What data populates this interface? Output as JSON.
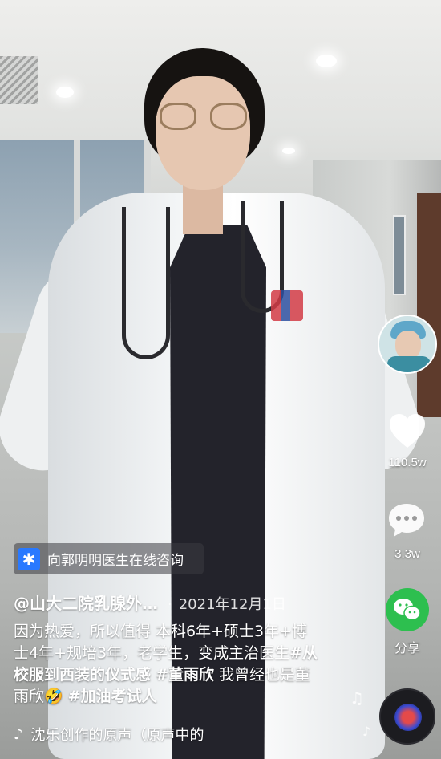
{
  "consult_banner": {
    "icon_glyph": "✱",
    "label": "向郭明明医生在线咨询"
  },
  "post": {
    "author": "@山大二院乳腺外…",
    "separator": "·",
    "date": "2021年12月1日",
    "caption_parts": [
      {
        "text": "因为热爱，所以值得 本科6年+硕士3年+博士4年+规培3年，老学生，变成主治医生",
        "tag": false
      },
      {
        "text": "#从校服到西装的仪式感",
        "tag": true
      },
      {
        "text": " ",
        "tag": false
      },
      {
        "text": "#董雨欣",
        "tag": true
      },
      {
        "text": " 我曾经也是董雨欣🤣 ",
        "tag": false
      },
      {
        "text": "#加油考试人",
        "tag": true
      }
    ]
  },
  "music": {
    "icon": "music-note-icon",
    "text": "沈乐创作的原声（原声中的"
  },
  "actions": {
    "likes": "110.5w",
    "comments": "3.3w",
    "share": "分享"
  },
  "colors": {
    "accent_red": "#ff2c55",
    "share_green": "#2dbf4f",
    "consult_blue": "#2979ff"
  }
}
